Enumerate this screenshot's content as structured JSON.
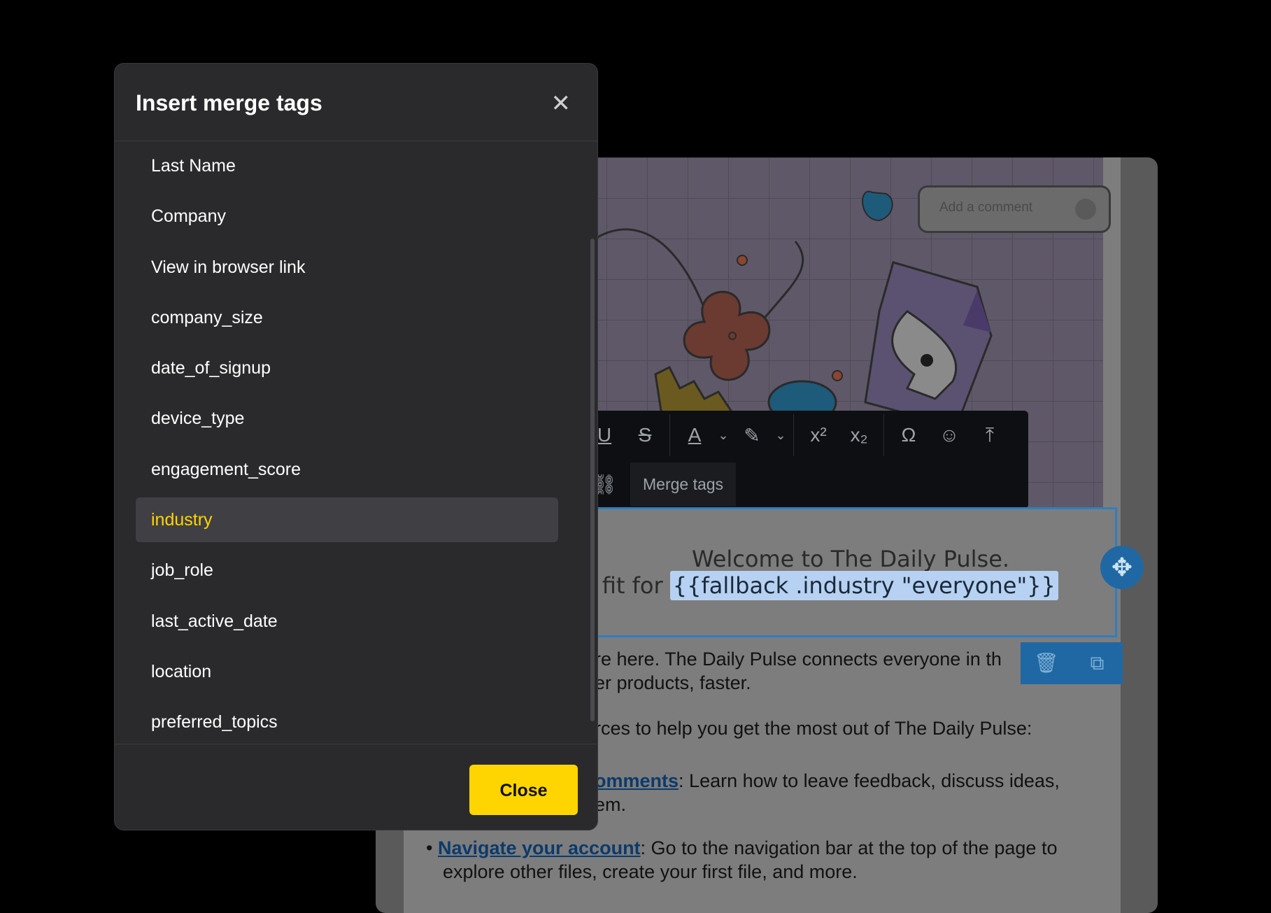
{
  "modal": {
    "title": "Insert merge tags",
    "close_icon": "close-icon",
    "close_button_label": "Close",
    "items": [
      {
        "label": "Last Name"
      },
      {
        "label": "Company"
      },
      {
        "label": "View in browser link"
      },
      {
        "label": "company_size"
      },
      {
        "label": "date_of_signup"
      },
      {
        "label": "device_type"
      },
      {
        "label": "engagement_score"
      },
      {
        "label": "industry",
        "selected": true
      },
      {
        "label": "job_role"
      },
      {
        "label": "last_active_date"
      },
      {
        "label": "location"
      },
      {
        "label": "preferred_topics"
      }
    ],
    "accent_color": "#ffd500"
  },
  "editor": {
    "comment_placeholder": "Add a comment",
    "toolbar": {
      "merge_tags_label": "Merge tags",
      "icons": [
        "underline-icon",
        "strikethrough-icon",
        "font-color-icon",
        "highlight-icon",
        "superscript-icon",
        "subscript-icon",
        "special-char-icon",
        "emoji-icon",
        "upload-icon",
        "unlink-icon"
      ]
    },
    "heading": "Welcome to The Daily Pulse.",
    "fit_prefix": "t fit for ",
    "selected_tag": "{{fallback .industry \"everyone\"}}",
    "paragraph1_line1": "are here. The Daily Pulse connects everyone in th",
    "paragraph1_line2": "tter products, faster.",
    "paragraph2": "urces to help you get the most out of The Daily Pulse:",
    "bullet1_link": "comments",
    "bullet1_text": ": Learn how to leave feedback, discuss ideas,",
    "bullet1_line2": "hem.",
    "bullet2_link": "Navigate your account",
    "bullet2_text": ": Go to the navigation bar at the top of the page to",
    "bullet2_line2": "explore other files, create your first file, and more."
  }
}
